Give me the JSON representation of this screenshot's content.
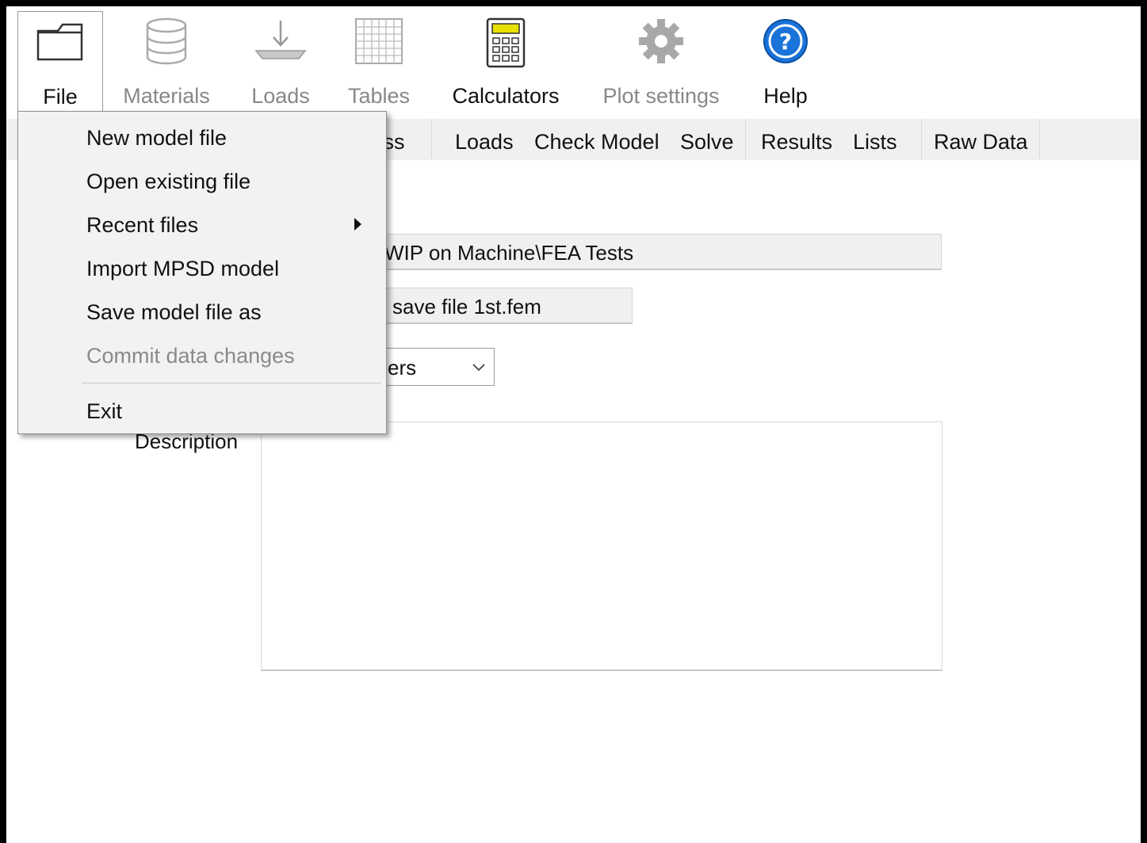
{
  "toolbar": {
    "file": "File",
    "materials": "Materials",
    "loads": "Loads",
    "tables": "Tables",
    "calculators": "Calculators",
    "plot_settings": "Plot settings",
    "help": "Help"
  },
  "tabs": [
    "tress",
    "Loads",
    "Check Model",
    "Solve",
    "Results",
    "Lists",
    "Raw Data"
  ],
  "form": {
    "folder_path": "WIP on Machine\\FEA Tests",
    "file_name": "save file 1st.fem",
    "units_partial": "ers",
    "description_label": "Description"
  },
  "file_menu": {
    "new_model": "New model file",
    "open_existing": "Open existing file",
    "recent_files": "Recent files",
    "import_mpsd": "Import MPSD model",
    "save_as": "Save model file as",
    "commit_changes": "Commit data changes",
    "exit": "Exit"
  },
  "colors": {
    "help_blue": "#1a73d9",
    "calculator_lcd": "#e8e000",
    "disabled_text": "#888888"
  }
}
